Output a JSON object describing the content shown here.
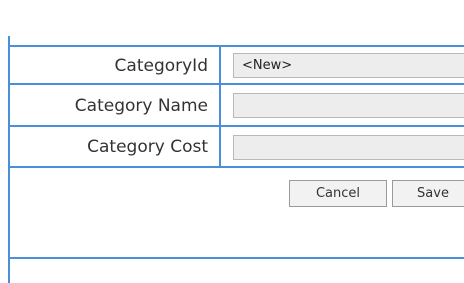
{
  "form": {
    "fields": [
      {
        "label": "CategoryId",
        "value": "<New>",
        "placeholder": ""
      },
      {
        "label": "Category Name",
        "value": "",
        "placeholder": ""
      },
      {
        "label": "Category Cost",
        "value": "",
        "placeholder": ""
      }
    ],
    "buttons": {
      "cancel_label": "Cancel",
      "save_label": "Save"
    }
  },
  "colors": {
    "border_accent": "#4a90d9",
    "field_background": "#ededed",
    "button_background": "#f2f2f2"
  }
}
